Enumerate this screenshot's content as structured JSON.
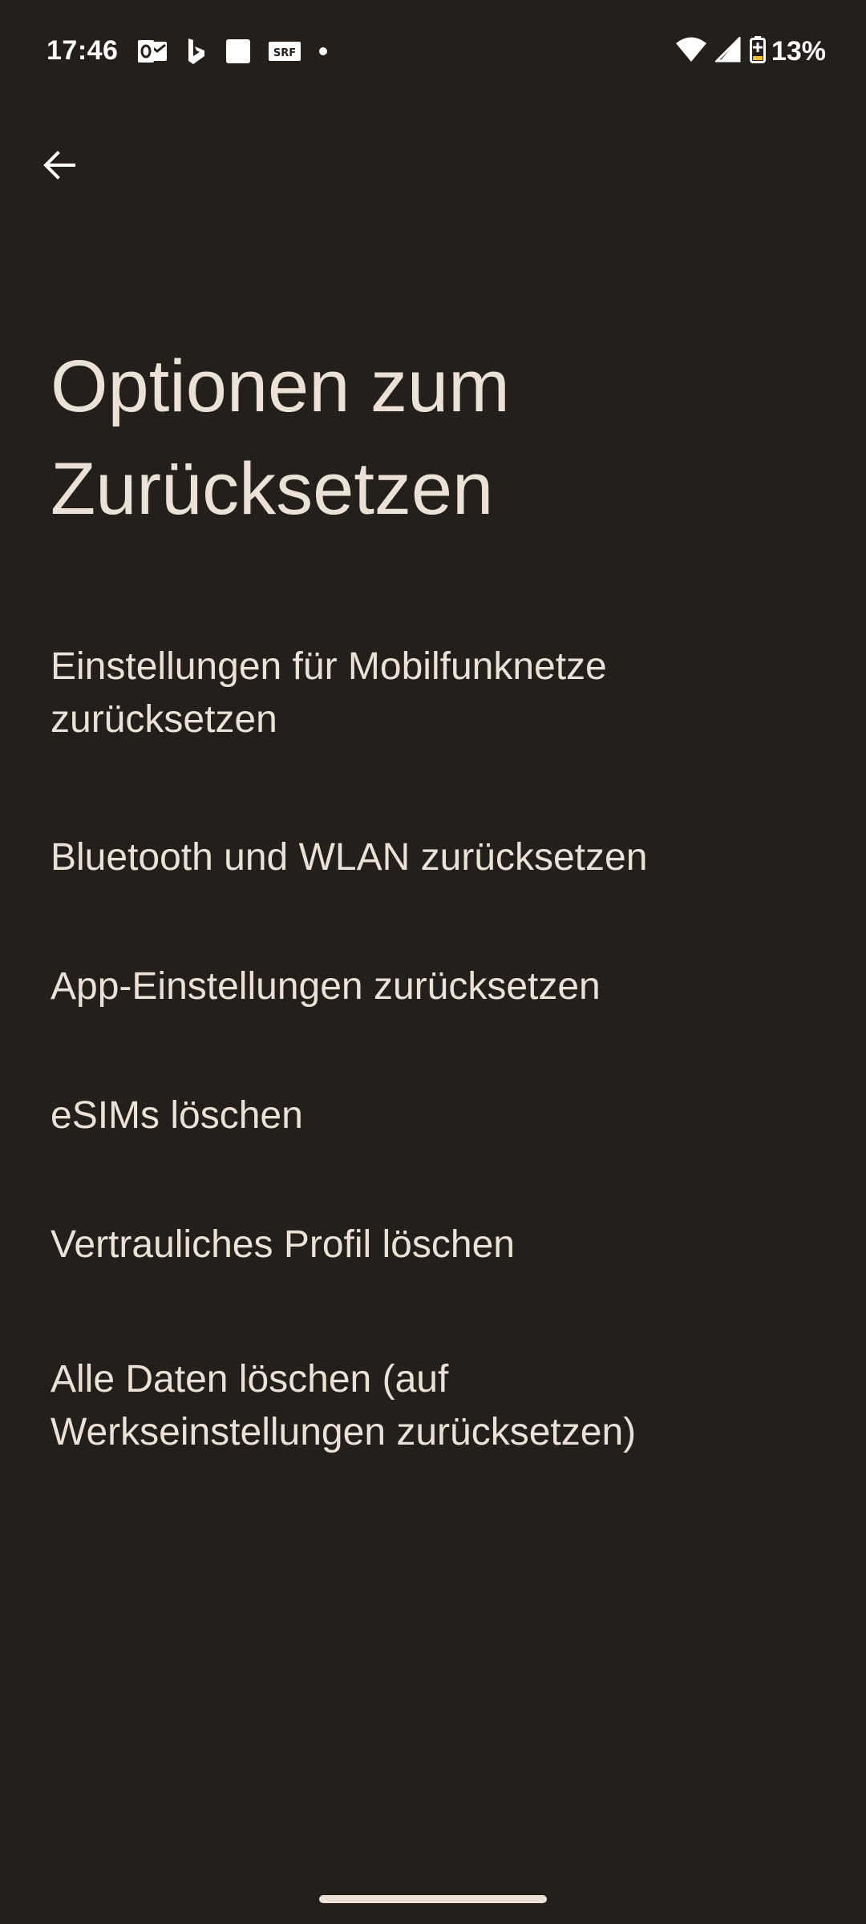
{
  "status_bar": {
    "time": "17:46",
    "notification_icons": [
      "outlook-icon",
      "bing-icon",
      "square-app-icon",
      "srf-icon",
      "more-dot-icon"
    ],
    "srf_label": "SRF",
    "battery_percent": "13%",
    "system_icons": [
      "wifi-icon",
      "cellular-signal-icon",
      "battery-charging-icon"
    ]
  },
  "navigation": {
    "back_icon": "arrow-left-icon"
  },
  "page": {
    "title_line1": "Optionen zum",
    "title_line2": "Zurücksetzen"
  },
  "options": [
    {
      "line1": "Einstellungen für Mobilfunknetze",
      "line2": "zurücksetzen"
    },
    {
      "line1": "Bluetooth und WLAN zurücksetzen"
    },
    {
      "line1": "App-Einstellungen zurücksetzen"
    },
    {
      "line1": "eSIMs löschen"
    },
    {
      "line1": "Vertrauliches Profil löschen"
    },
    {
      "line1": "Alle Daten löschen (auf",
      "line2": "Werkseinstellungen zurücksetzen)"
    }
  ],
  "colors": {
    "background": "#241f1b",
    "text": "#ece1d6",
    "status_text": "#ffffff",
    "battery_accent": "#f0c23a"
  }
}
